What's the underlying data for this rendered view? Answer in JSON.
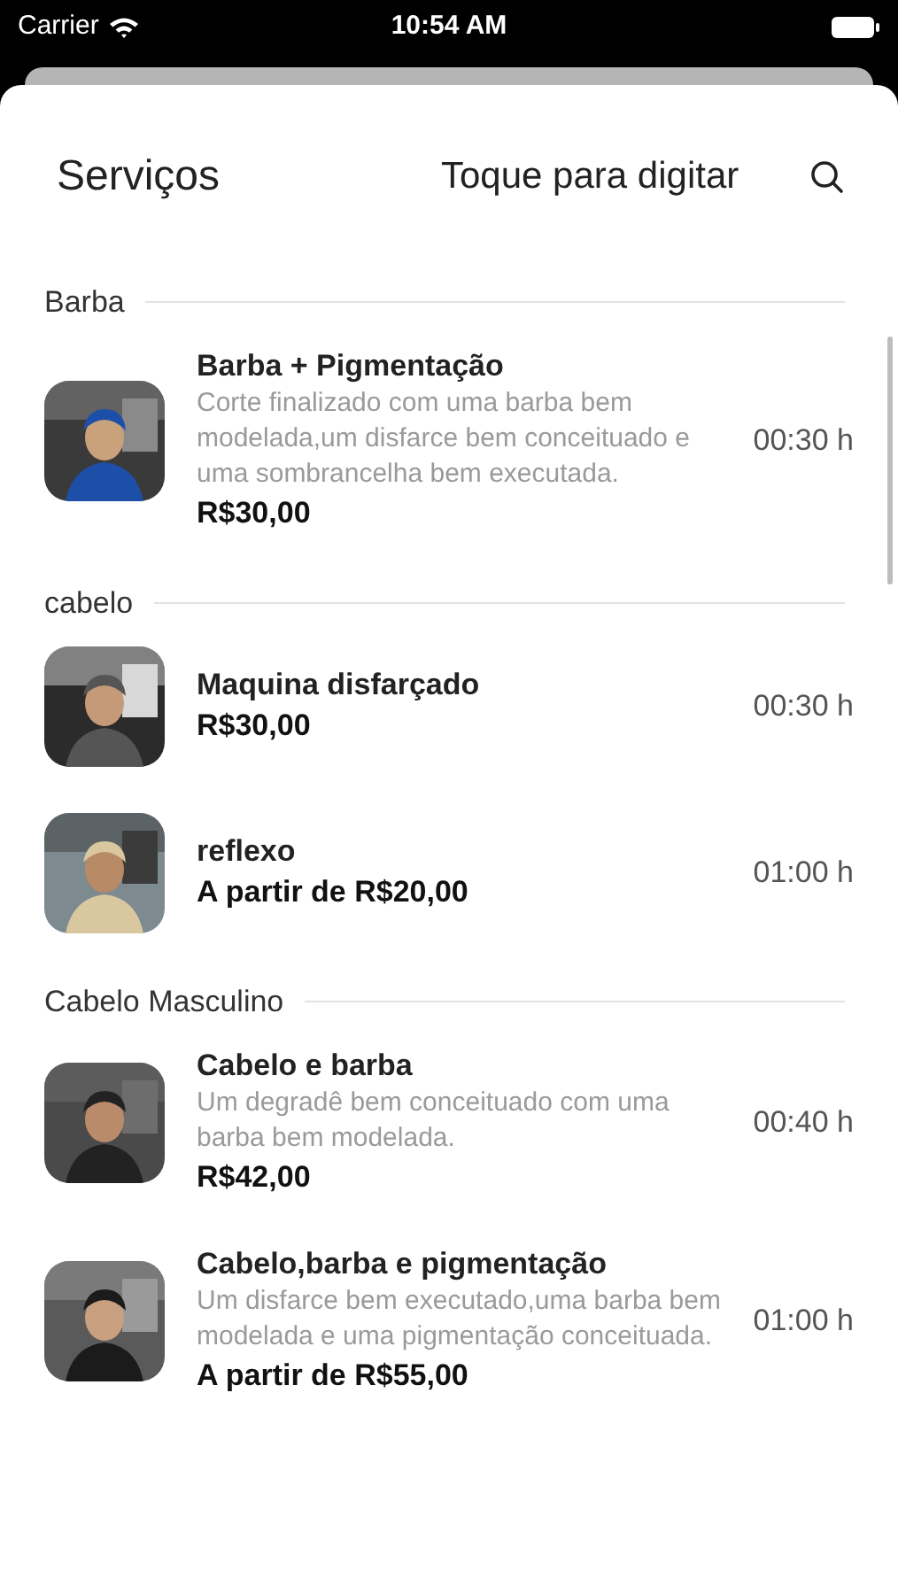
{
  "status_bar": {
    "carrier": "Carrier",
    "time": "10:54 AM"
  },
  "header": {
    "title": "Serviços",
    "search": {
      "placeholder": "Toque para digitar"
    }
  },
  "sections": [
    {
      "title": "Barba",
      "items": [
        {
          "name": "Barba + Pigmentação",
          "description": "Corte finalizado com uma barba bem modelada,um disfarce bem conceituado e uma sombrancelha bem executada.",
          "price": "R$30,00",
          "duration": "00:30 h"
        }
      ]
    },
    {
      "title": "cabelo",
      "items": [
        {
          "name": "Maquina disfarçado",
          "price": "R$30,00",
          "duration": "00:30 h"
        },
        {
          "name": "reflexo",
          "price": "A partir de R$20,00",
          "duration": "01:00 h"
        }
      ]
    },
    {
      "title": "Cabelo Masculino",
      "items": [
        {
          "name": "Cabelo e barba",
          "description": "Um degradê bem conceituado com uma barba bem modelada.",
          "price": "R$42,00",
          "duration": "00:40 h"
        },
        {
          "name": "Cabelo,barba e pigmentação",
          "description": "Um disfarce bem executado,uma barba bem modelada e uma pigmentação conceituada.",
          "price": "A partir de R$55,00",
          "duration": "01:00 h"
        }
      ]
    }
  ]
}
